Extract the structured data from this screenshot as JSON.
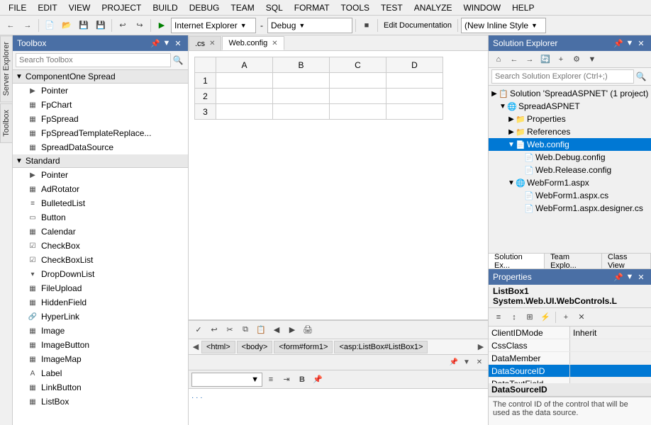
{
  "menubar": {
    "items": [
      "FILE",
      "EDIT",
      "VIEW",
      "PROJECT",
      "BUILD",
      "DEBUG",
      "TEAM",
      "SQL",
      "FORMAT",
      "TOOLS",
      "TEST",
      "ANALYZE",
      "WINDOW",
      "HELP"
    ]
  },
  "toolbar": {
    "browser": "Internet Explorer",
    "mode": "Debug",
    "style": "(New Inline Style",
    "edit_doc_label": "Edit Documentation"
  },
  "toolbox": {
    "title": "Toolbox",
    "search_placeholder": "Search Toolbox",
    "groups": [
      {
        "name": "ComponentOne Spread",
        "items": [
          {
            "label": "Pointer",
            "icon": "▶"
          },
          {
            "label": "FpChart",
            "icon": "▦"
          },
          {
            "label": "FpSpread",
            "icon": "▦"
          },
          {
            "label": "FpSpreadTemplateReplace...",
            "icon": "▦"
          },
          {
            "label": "SpreadDataSource",
            "icon": "▦"
          }
        ]
      },
      {
        "name": "Standard",
        "items": [
          {
            "label": "Pointer",
            "icon": "▶"
          },
          {
            "label": "AdRotator",
            "icon": "▦"
          },
          {
            "label": "BulletedList",
            "icon": "≡"
          },
          {
            "label": "Button",
            "icon": "▭"
          },
          {
            "label": "Calendar",
            "icon": "▦"
          },
          {
            "label": "CheckBox",
            "icon": "☑"
          },
          {
            "label": "CheckBoxList",
            "icon": "☑"
          },
          {
            "label": "DropDownList",
            "icon": "▾"
          },
          {
            "label": "FileUpload",
            "icon": "▦"
          },
          {
            "label": "HiddenField",
            "icon": "▦"
          },
          {
            "label": "HyperLink",
            "icon": "🔗"
          },
          {
            "label": "Image",
            "icon": "▦"
          },
          {
            "label": "ImageButton",
            "icon": "▦"
          },
          {
            "label": "ImageMap",
            "icon": "▦"
          },
          {
            "label": "Label",
            "icon": "A"
          },
          {
            "label": "LinkButton",
            "icon": "▦"
          },
          {
            "label": "ListBox",
            "icon": "▦"
          }
        ]
      }
    ]
  },
  "tabs": [
    {
      "label": ".cs",
      "active": false
    },
    {
      "label": "Web.config",
      "active": true
    }
  ],
  "spreadsheet": {
    "columns": [
      "A",
      "B",
      "C",
      "D"
    ],
    "rows": [
      "1",
      "2",
      "3"
    ]
  },
  "nav_breadcrumb": {
    "items": [
      "<html>",
      "<body>",
      "<form#form1>",
      "<asp:ListBox#ListBox1>"
    ]
  },
  "output_panel": {
    "dropdown_value": ""
  },
  "solution_explorer": {
    "title": "Solution Explorer",
    "search_placeholder": "Search Solution Explorer (Ctrl+;)",
    "tree": [
      {
        "label": "Solution 'SpreadASPNET' (1 project)",
        "indent": 0,
        "icon": "📋",
        "arrow": "▶"
      },
      {
        "label": "SpreadASPNET",
        "indent": 1,
        "icon": "🌐",
        "arrow": "▼"
      },
      {
        "label": "Properties",
        "indent": 2,
        "icon": "📁",
        "arrow": "▶"
      },
      {
        "label": "References",
        "indent": 2,
        "icon": "📁",
        "arrow": "▶"
      },
      {
        "label": "Web.config",
        "indent": 2,
        "icon": "📄",
        "arrow": "▼",
        "selected": true
      },
      {
        "label": "Web.Debug.config",
        "indent": 3,
        "icon": "📄",
        "arrow": ""
      },
      {
        "label": "Web.Release.config",
        "indent": 3,
        "icon": "📄",
        "arrow": ""
      },
      {
        "label": "WebForm1.aspx",
        "indent": 2,
        "icon": "🌐",
        "arrow": "▼"
      },
      {
        "label": "WebForm1.aspx.cs",
        "indent": 3,
        "icon": "📄",
        "arrow": ""
      },
      {
        "label": "WebForm1.aspx.designer.cs",
        "indent": 3,
        "icon": "📄",
        "arrow": ""
      }
    ],
    "tabs": [
      "Solution Ex...",
      "Team Explo...",
      "Class View"
    ]
  },
  "properties": {
    "title": "Properties",
    "selected": "ListBox1 System.Web.UI.WebControls.L",
    "rows": [
      {
        "name": "ClientIDMode",
        "value": "Inherit"
      },
      {
        "name": "CssClass",
        "value": ""
      },
      {
        "name": "DataMember",
        "value": ""
      },
      {
        "name": "DataSourceID",
        "value": ""
      },
      {
        "name": "DataTextField",
        "value": ""
      }
    ],
    "selected_prop": "DataSourceID",
    "description": "The control ID of the control that will be used as the data source."
  },
  "icons": {
    "search": "🔍",
    "close": "✕",
    "pin": "📌",
    "arrow_down": "▼",
    "arrow_right": "▶",
    "arrow_left": "◀",
    "arrow_left2": "◀",
    "arrow_right2": "▶",
    "undo": "↩",
    "redo": "↪",
    "play": "▶",
    "stop": "■",
    "cut": "✂",
    "copy": "⧉",
    "paste": "📋",
    "save": "💾",
    "new": "📄",
    "open": "📂",
    "refresh": "🔄",
    "back": "←",
    "forward": "→",
    "home": "⌂",
    "settings": "⚙",
    "print": "🖨",
    "bold": "B",
    "align": "≡",
    "indent": "⇥"
  }
}
